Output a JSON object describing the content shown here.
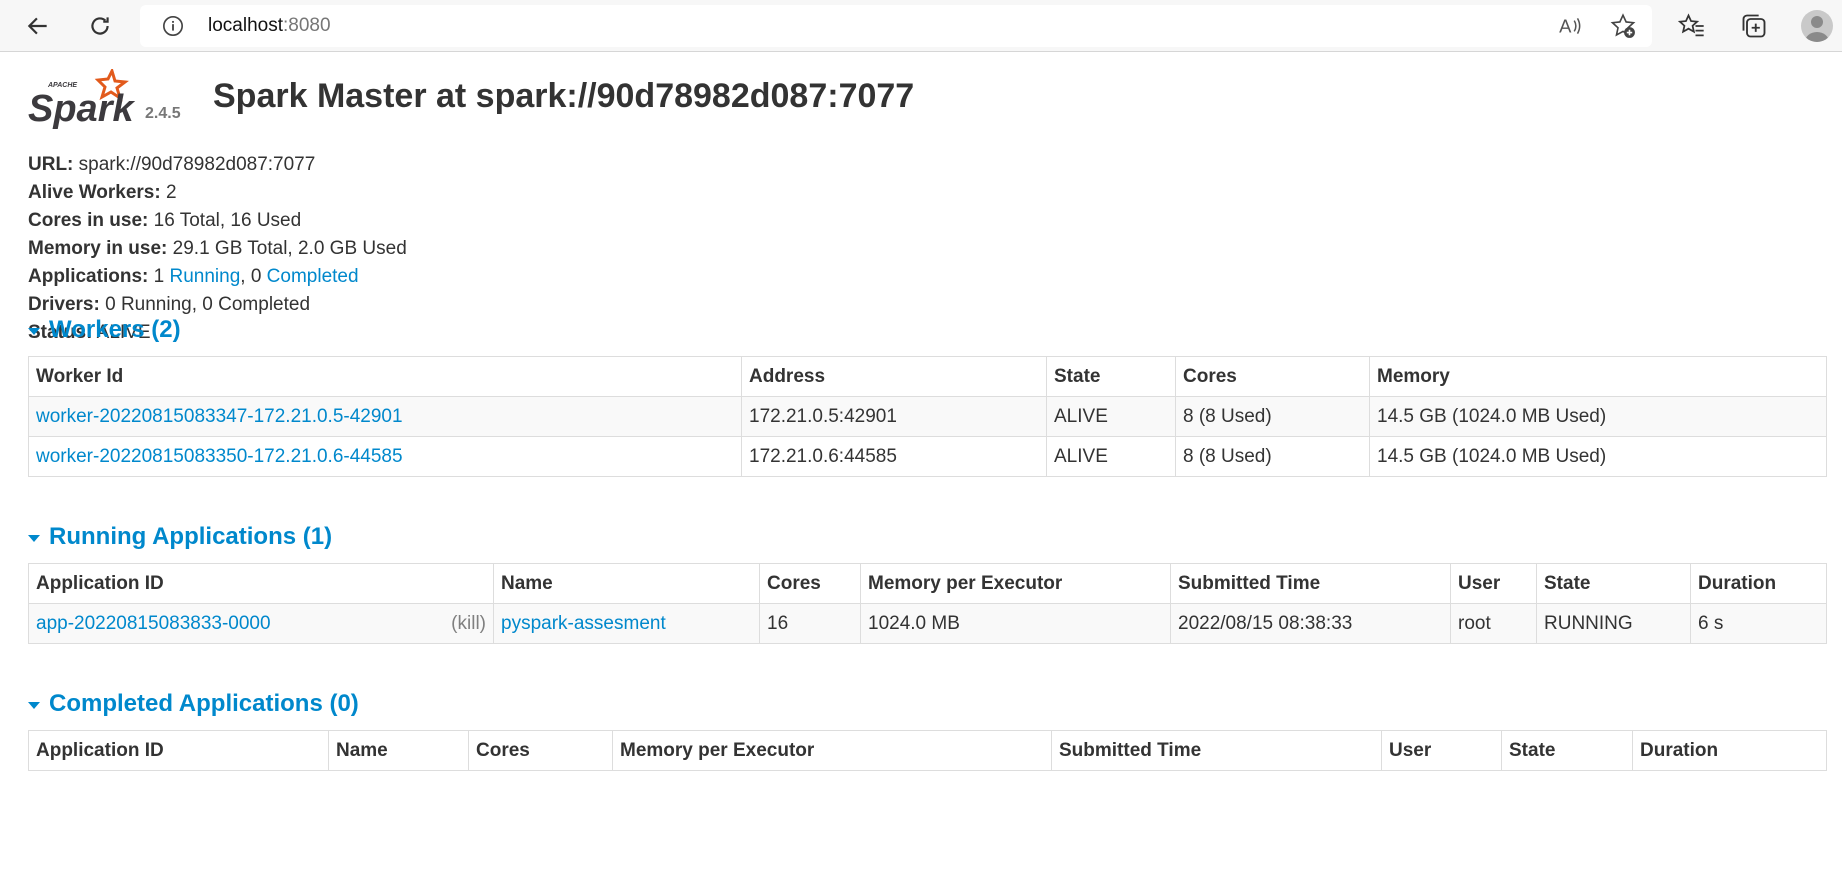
{
  "browser": {
    "url_host": "localhost",
    "url_port": ":8080"
  },
  "header": {
    "version": "2.4.5",
    "title": "Spark Master at spark://90d78982d087:7077"
  },
  "summary": {
    "url_label": "URL:",
    "url_value": "spark://90d78982d087:7077",
    "alive_label": "Alive Workers:",
    "alive_value": "2",
    "cores_label": "Cores in use:",
    "cores_value": "16 Total, 16 Used",
    "memory_label": "Memory in use:",
    "memory_value": "29.1 GB Total, 2.0 GB Used",
    "apps_label": "Applications:",
    "apps_running_count": "1",
    "apps_running_link": "Running",
    "apps_sep": ", 0",
    "apps_completed_link": "Completed",
    "drivers_label": "Drivers:",
    "drivers_value": "0 Running, 0 Completed",
    "status_label": "Status:",
    "status_value": "ALIVE"
  },
  "workers": {
    "heading": "Workers (2)",
    "columns": [
      "Worker Id",
      "Address",
      "State",
      "Cores",
      "Memory"
    ],
    "rows": [
      [
        "worker-20220815083347-172.21.0.5-42901",
        "172.21.0.5:42901",
        "ALIVE",
        "8 (8 Used)",
        "14.5 GB (1024.0 MB Used)"
      ],
      [
        "worker-20220815083350-172.21.0.6-44585",
        "172.21.0.6:44585",
        "ALIVE",
        "8 (8 Used)",
        "14.5 GB (1024.0 MB Used)"
      ]
    ]
  },
  "running": {
    "heading": "Running Applications (1)",
    "columns": [
      "Application ID",
      "Name",
      "Cores",
      "Memory per Executor",
      "Submitted Time",
      "User",
      "State",
      "Duration"
    ],
    "rows": [
      {
        "id": "app-20220815083833-0000",
        "kill": "(kill)",
        "name": "pyspark-assesment",
        "cores": "16",
        "memory": "1024.0 MB",
        "submitted": "2022/08/15 08:38:33",
        "user": "root",
        "state": "RUNNING",
        "duration": "6 s"
      }
    ]
  },
  "completed": {
    "heading": "Completed Applications (0)",
    "columns": [
      "Application ID",
      "Name",
      "Cores",
      "Memory per Executor",
      "Submitted Time",
      "User",
      "State",
      "Duration"
    ]
  },
  "colors": {
    "link": "#0088cc",
    "logo_orange": "#e25a1c",
    "text": "#333333"
  }
}
